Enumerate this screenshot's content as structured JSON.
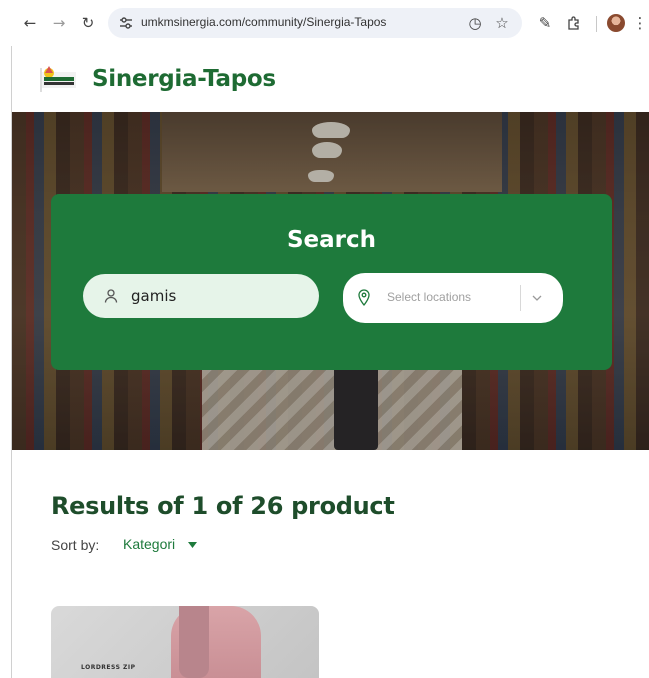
{
  "browser": {
    "url": "umkmsinergia.com/community/Sinergia-Tapos",
    "icons": [
      "back-icon",
      "forward-icon",
      "reload-icon",
      "site-settings-icon",
      "speed-icon",
      "star-icon",
      "pen-icon",
      "extensions-icon",
      "profile-avatar",
      "menu-icon"
    ]
  },
  "site": {
    "brand": "Sinergia-Tapos",
    "accent_color": "#1e7a3c",
    "brand_color": "#1e6b33"
  },
  "search": {
    "title": "Search",
    "keyword_value": "gamis",
    "location_placeholder": "Select locations"
  },
  "results": {
    "title": "Results of 1 of 26 product",
    "sort_label": "Sort by:",
    "sort_value": "Kategori"
  },
  "product": {
    "caption": "LORDRESS ZIP"
  }
}
